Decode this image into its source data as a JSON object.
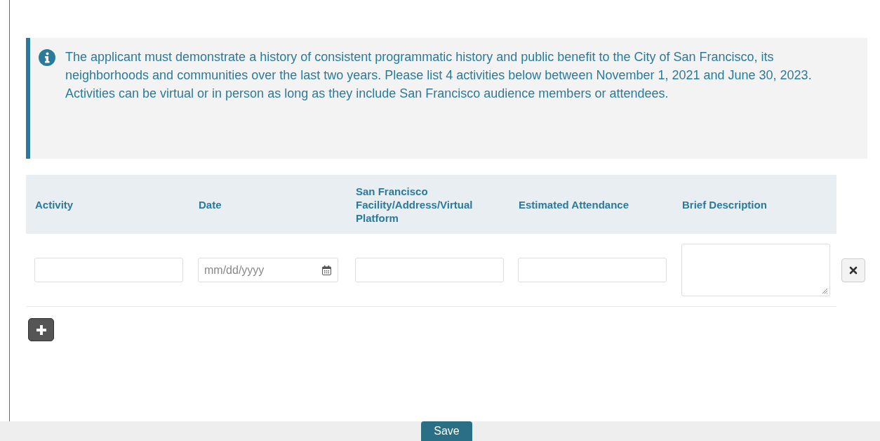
{
  "notice": {
    "text": "The applicant must demonstrate a history of consistent programmatic history and public benefit to the City of San Francisco, its neighborhoods and communities over the last two years. Please list 4 activities below between November 1, 2021 and June 30, 2023. Activities can be virtual or in person as long as they include San Francisco audience members or attendees."
  },
  "table": {
    "columns": [
      "Activity",
      "Date",
      "San Francisco Facility/Address/Virtual Platform",
      "Estimated Attendance",
      "Brief Description"
    ],
    "rows": [
      {
        "cells": [
          {
            "kind": "text"
          },
          {
            "kind": "date",
            "placeholder": "mm/dd/yyyy"
          },
          {
            "kind": "text"
          },
          {
            "kind": "text"
          },
          {
            "kind": "textarea"
          }
        ]
      }
    ]
  },
  "footer": {
    "save_button": "Save"
  }
}
